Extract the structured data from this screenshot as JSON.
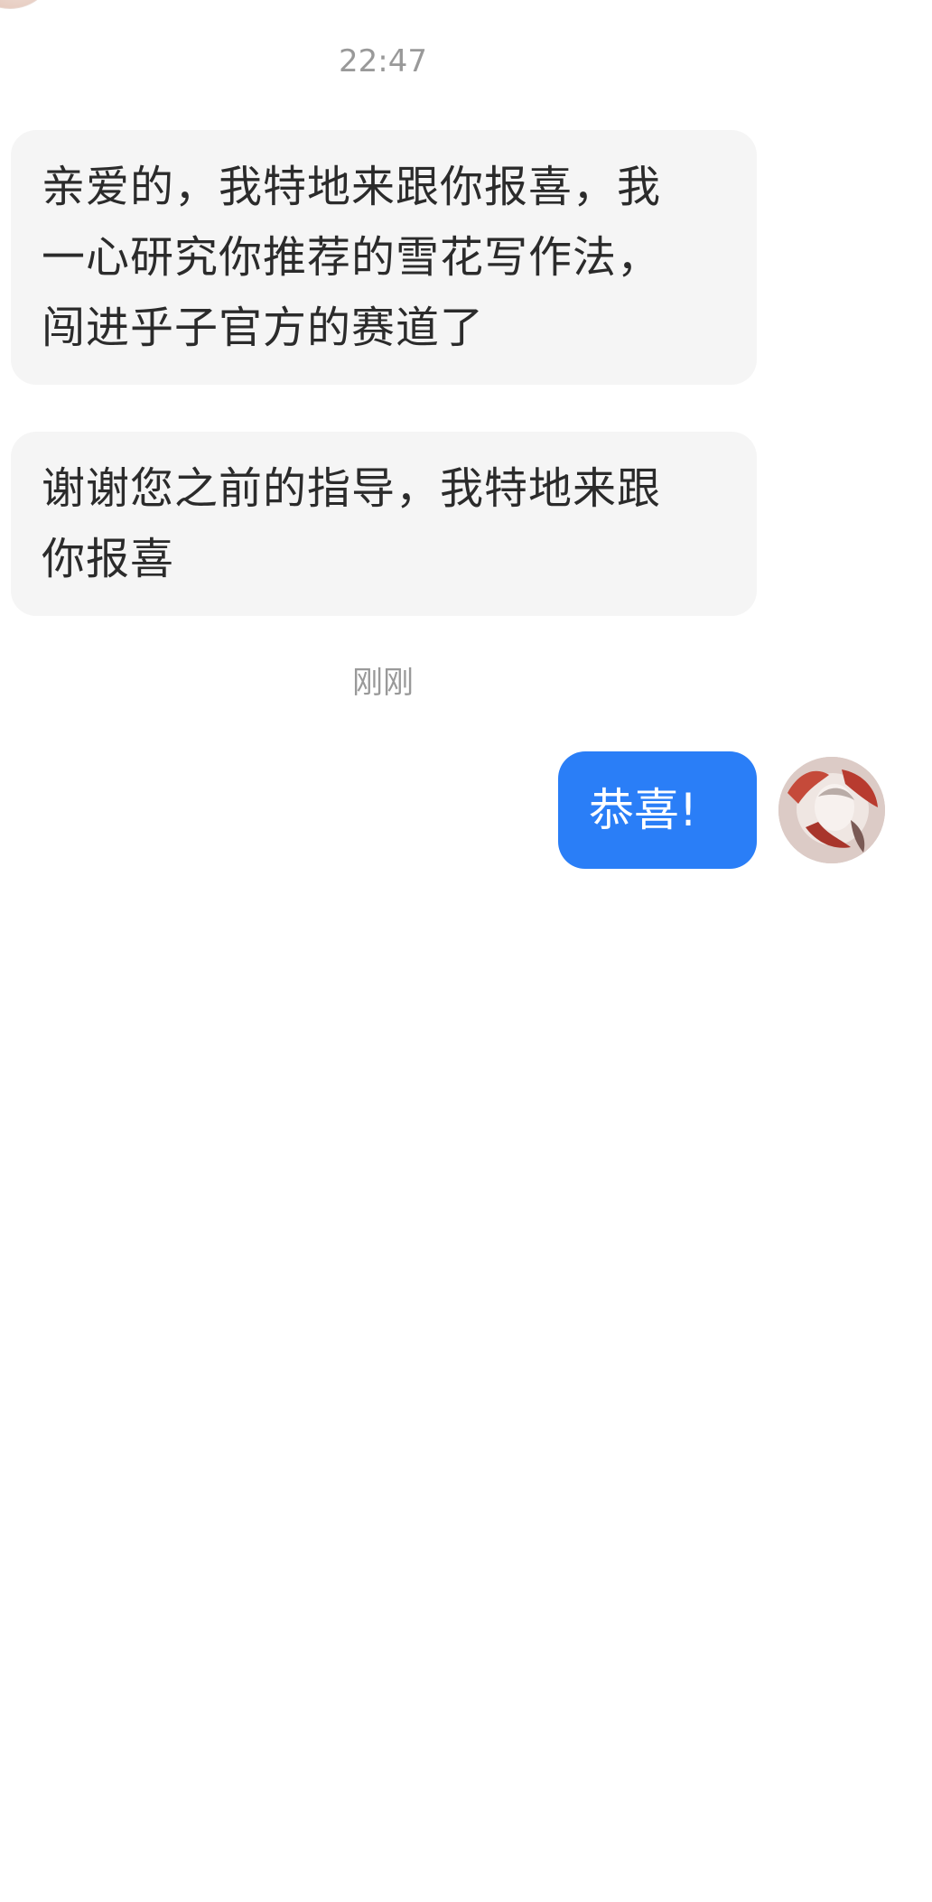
{
  "conversation": {
    "timestamps": {
      "first": "22:47",
      "second": "刚刚"
    },
    "incoming_messages": [
      {
        "lines": [
          "亲爱的，我特地来跟你报喜，我",
          "一心研究你推荐的雪花写作法，",
          "闯进乎子官方的赛道了"
        ]
      },
      {
        "lines": [
          "谢谢您之前的指导，我特地来跟",
          "你报喜"
        ]
      }
    ],
    "outgoing_messages": [
      {
        "text": "恭喜!"
      }
    ]
  },
  "colors": {
    "incoming_bubble": "#f5f5f5",
    "outgoing_bubble": "#2a7ef7",
    "timestamp_text": "#999999",
    "message_text": "#2b2b2b"
  },
  "icons": {
    "peer_avatar": "avatar",
    "self_avatar": "avatar"
  }
}
